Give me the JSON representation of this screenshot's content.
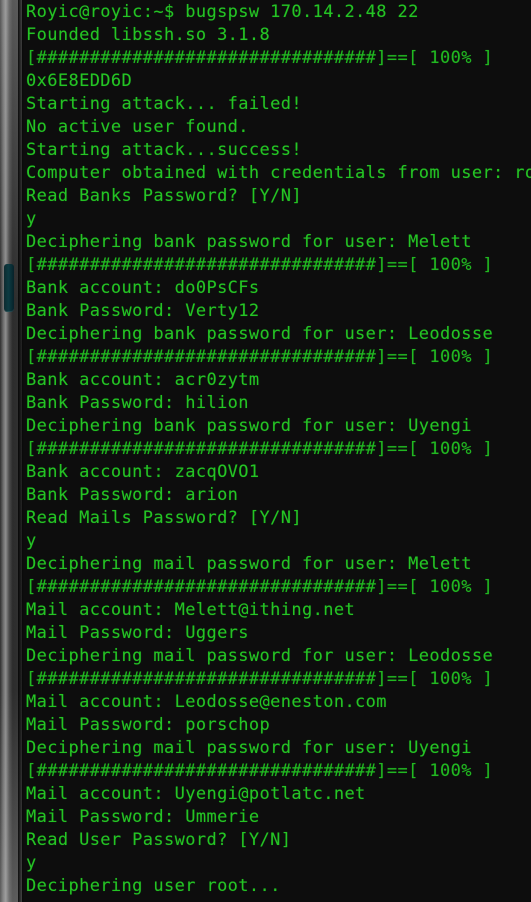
{
  "terminal": {
    "background_color": "#0d0d0d",
    "text_color": "#24c424",
    "scrollbar_thumb_color": "#0c3b42",
    "prompt": "Royic@royic:~$",
    "command": "bugspsw 170.14.2.48 22",
    "progress_bar": "[################################]==[ 100% ]",
    "lines": [
      "Royic@royic:~$ bugspsw 170.14.2.48 22",
      "Founded libssh.so 3.1.8",
      "[################################]==[ 100% ]",
      "0x6E8EDD6D",
      "Starting attack... failed!",
      "No active user found.",
      "Starting attack...success!",
      "Computer obtained with credentials from user: root",
      "Read Banks Password? [Y/N]",
      "y",
      "Deciphering bank password for user: Melett",
      "[################################]==[ 100% ]",
      "Bank account: do0PsCFs",
      "Bank Password: Verty12",
      "Deciphering bank password for user: Leodosse",
      "[################################]==[ 100% ]",
      "Bank account: acr0zytm",
      "Bank Password: hilion",
      "Deciphering bank password for user: Uyengi",
      "[################################]==[ 100% ]",
      "Bank account: zacqOVO1",
      "Bank Password: arion",
      "Read Mails Password? [Y/N]",
      "y",
      "Deciphering mail password for user: Melett",
      "[################################]==[ 100% ]",
      "Mail account: Melett@ithing.net",
      "Mail Password: Uggers",
      "Deciphering mail password for user: Leodosse",
      "[################################]==[ 100% ]",
      "Mail account: Leodosse@eneston.com",
      "Mail Password: porschop",
      "Deciphering mail password for user: Uyengi",
      "[################################]==[ 100% ]",
      "Mail account: Uyengi@potlatc.net",
      "Mail Password: Ummerie",
      "Read User Password? [Y/N]",
      "y",
      "Deciphering user root..."
    ],
    "session": {
      "target_ip": "170.14.2.48",
      "target_port": "22",
      "library": "libssh.so 3.1.8",
      "hash_token": "0x6E8EDD6D",
      "obtained_user": "root"
    },
    "bank_records": [
      {
        "user": "Melett",
        "account": "do0PsCFs",
        "password": "Verty12"
      },
      {
        "user": "Leodosse",
        "account": "acr0zytm",
        "password": "hilion"
      },
      {
        "user": "Uyengi",
        "account": "zacqOVO1",
        "password": "arion"
      }
    ],
    "mail_records": [
      {
        "user": "Melett",
        "account": "Melett@ithing.net",
        "password": "Uggers"
      },
      {
        "user": "Leodosse",
        "account": "Leodosse@eneston.com",
        "password": "porschop"
      },
      {
        "user": "Uyengi",
        "account": "Uyengi@potlatc.net",
        "password": "Ummerie"
      }
    ],
    "prompts": [
      {
        "question": "Read Banks Password? [Y/N]",
        "answer": "y"
      },
      {
        "question": "Read Mails Password? [Y/N]",
        "answer": "y"
      },
      {
        "question": "Read User Password? [Y/N]",
        "answer": "y"
      }
    ]
  }
}
